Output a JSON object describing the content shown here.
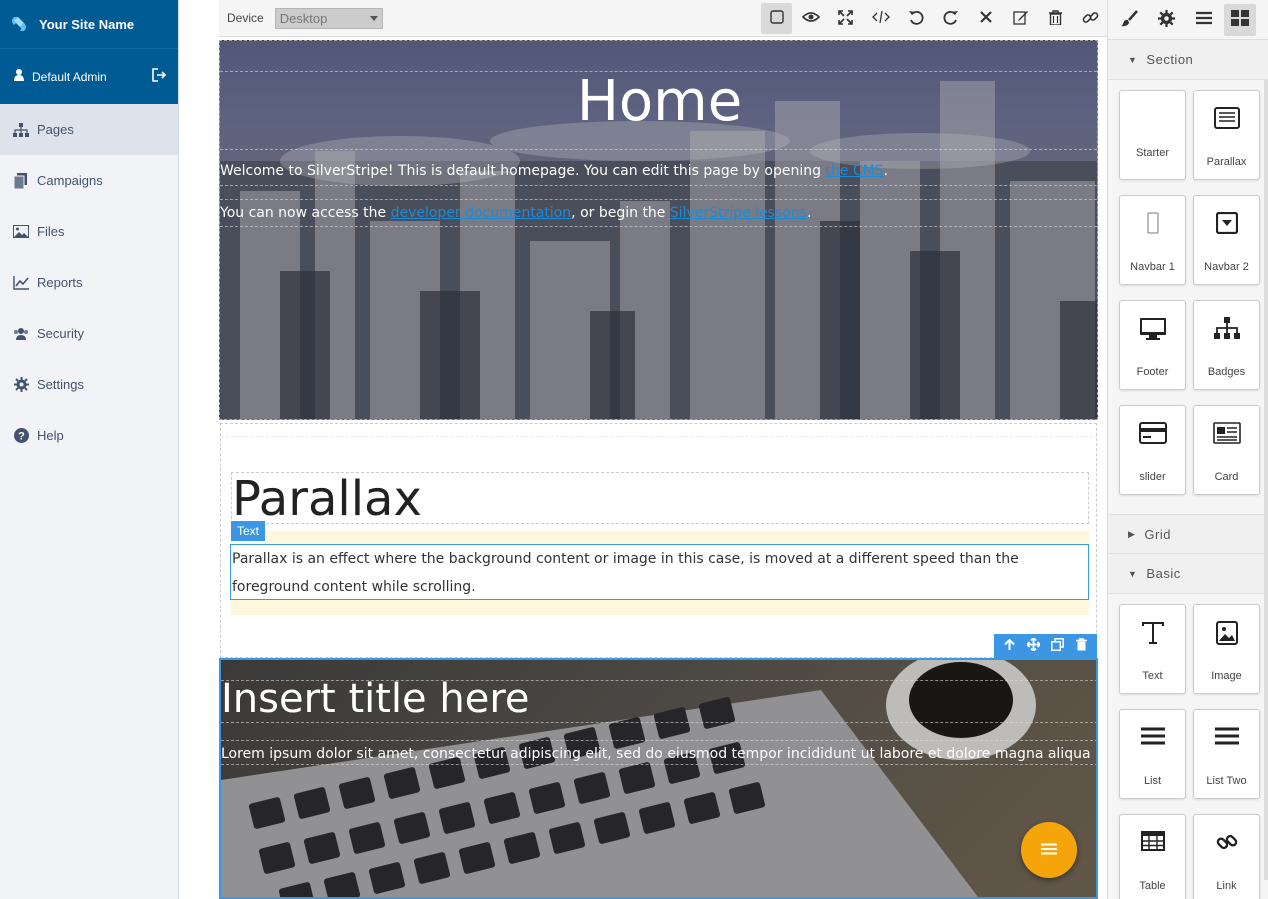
{
  "sidebar": {
    "site_name": "Your Site Name",
    "user_name": "Default Admin",
    "items": [
      {
        "label": "Pages",
        "icon": "sitemap-icon"
      },
      {
        "label": "Campaigns",
        "icon": "campaigns-icon"
      },
      {
        "label": "Files",
        "icon": "image-icon"
      },
      {
        "label": "Reports",
        "icon": "chart-icon"
      },
      {
        "label": "Security",
        "icon": "users-icon"
      },
      {
        "label": "Settings",
        "icon": "gear-icon"
      },
      {
        "label": "Help",
        "icon": "help-icon"
      }
    ]
  },
  "toolbar": {
    "device_label": "Device",
    "device_value": "Desktop",
    "icons": [
      "sw-visibility-icon",
      "preview-icon",
      "fullscreen-icon",
      "code-icon",
      "undo-icon",
      "redo-icon",
      "clear-icon",
      "edit-icon",
      "delete-icon",
      "link-icon"
    ]
  },
  "right_tabs": [
    "style-manager-icon",
    "settings-icon",
    "layer-manager-icon",
    "blocks-icon"
  ],
  "canvas": {
    "hero_title": "Home",
    "hero_p1_before": "Welcome to SilverStripe! This is default homepage. You can edit this page by opening ",
    "hero_p1_link": "the CMS",
    "hero_p1_after": ".",
    "hero_p2_before": "You can now access the ",
    "hero_p2_link1": "developer documentation",
    "hero_p2_mid": ", or begin the ",
    "hero_p2_link2": "SilverStripe lessons",
    "hero_p2_after": ".",
    "parallax_title": "Parallax",
    "text_badge": "Text",
    "parallax_text": "Parallax is an effect where the background content or image in this case, is moved at a different speed than the foreground content while scrolling.",
    "laptop_title": "Insert title here",
    "laptop_text": "Lorem ipsum dolor sit amet, consectetur adipiscing elit, sed do eiusmod tempor incididunt ut labore et dolore magna aliqua"
  },
  "blocks_panel": {
    "section_label": "Section",
    "grid_label": "Grid",
    "basic_label": "Basic",
    "section_blocks": [
      "Starter",
      "Parallax",
      "Navbar 1",
      "Navbar 2",
      "Footer",
      "Badges",
      "slider",
      "Card"
    ],
    "basic_blocks": [
      "Text",
      "Image",
      "List",
      "List Two",
      "Table",
      "Link"
    ]
  }
}
